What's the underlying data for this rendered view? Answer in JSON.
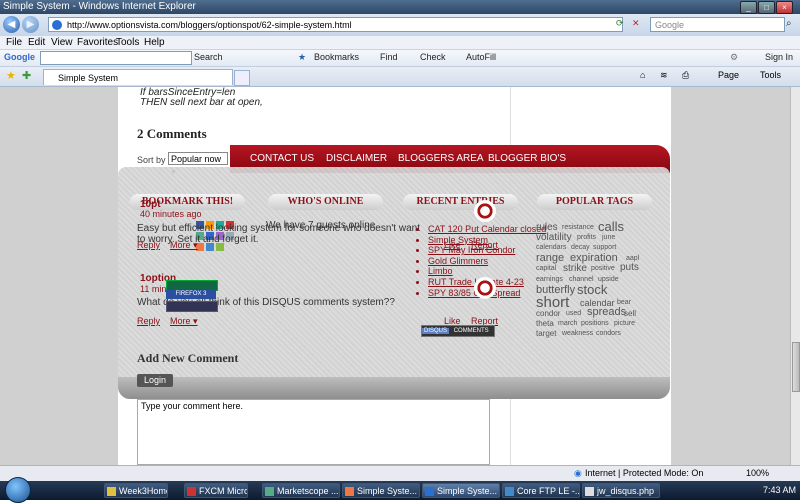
{
  "window": {
    "title": "Simple System - Windows Internet Explorer"
  },
  "address": {
    "url": "http://www.optionsvista.com/bloggers/optionspot/62-simple-system.html",
    "search_placeholder": "Google"
  },
  "menu": [
    "File",
    "Edit",
    "View",
    "Favorites",
    "Tools",
    "Help"
  ],
  "google_toolbar": {
    "label": "Google",
    "search": "Search",
    "bookmarks": "Bookmarks",
    "find": "Find",
    "check": "Check",
    "autofill": "AutoFill",
    "signin": "Sign In"
  },
  "tab": {
    "title": "Simple System"
  },
  "command_bar": {
    "page": "Page",
    "tools": "Tools"
  },
  "article": {
    "code_line1": "If barsSinceEntry=len",
    "code_line2": "THEN sell next bar at open,"
  },
  "comments": {
    "heading": "2 Comments",
    "sort_label": "Sort by",
    "sort_value": "Popular now",
    "items": [
      {
        "author": "10pt",
        "time": "40 minutes ago",
        "text": "Easy but efficient looking system for someone who doesn't want to worry. Set it and forget it.",
        "reply": "Reply",
        "more": "More ▾"
      },
      {
        "author": "1option",
        "time": "11 minutes ago",
        "text": "What do you all think of this DISQUS comments system??",
        "reply": "Reply",
        "more": "More ▾"
      }
    ],
    "like": "Like",
    "report": "Report",
    "disqus": "DISQUS",
    "disqus_comments": "COMMENTS",
    "new_comment_heading": "Add New Comment",
    "login": "Login",
    "comment_placeholder": "Type your comment here."
  },
  "nav": [
    "CONTACT US",
    "DISCLAIMER",
    "BLOGGERS AREA",
    "BLOGGER BIO'S"
  ],
  "columns": {
    "bookmark": "BOOKMARK THIS!",
    "online": "WHO'S ONLINE",
    "online_text": "We have 7 guests online",
    "recent": "RECENT ENTRIES",
    "popular": "POPULAR TAGS"
  },
  "recent_entries": [
    "CAT 120 Put Calendar closed",
    "Simple System",
    "SPY May Iron Condor",
    "Gold Glimmers",
    "Limbo",
    "RUT Trade Update 4-23",
    "SPY 83/85 Call Spread"
  ],
  "tags": {
    "rules": "rules",
    "resistance": "resistance",
    "calls": "calls",
    "volatility": "volatility",
    "profits": "profits",
    "june": "june",
    "calendars": "calendars",
    "decay": "decay",
    "support": "support",
    "range": "range",
    "expiration": "expiration",
    "aapl": "aapl",
    "capital": "capital",
    "strike": "strike",
    "positive": "positive",
    "puts": "puts",
    "earnings": "earnings",
    "channel": "channel",
    "upside": "upside",
    "butterfly": "butterfly",
    "stock": "stock",
    "short": "short",
    "calendar": "calendar",
    "bear": "bear",
    "condor": "condor",
    "used": "used",
    "spreads": "spreads",
    "sell": "sell",
    "theta": "theta",
    "march": "march",
    "positions": "positions",
    "picture": "picture",
    "target": "target",
    "weakness": "weakness",
    "condors": "condors"
  },
  "badges": {
    "firefox": "FIREFOX 3"
  },
  "status": {
    "zone": "Internet | Protected Mode: On",
    "zoom": "100%"
  },
  "taskbar": {
    "items": [
      "Week3Home...",
      "FXCM Micro ...",
      "Marketscope ...",
      "Simple Syste...",
      "Simple Syste...",
      "Core FTP LE -...",
      "jw_disqus.php"
    ],
    "clock": "7:43 AM"
  },
  "colors": {
    "accent": "#8a1018",
    "nav_red": "#b51622"
  }
}
